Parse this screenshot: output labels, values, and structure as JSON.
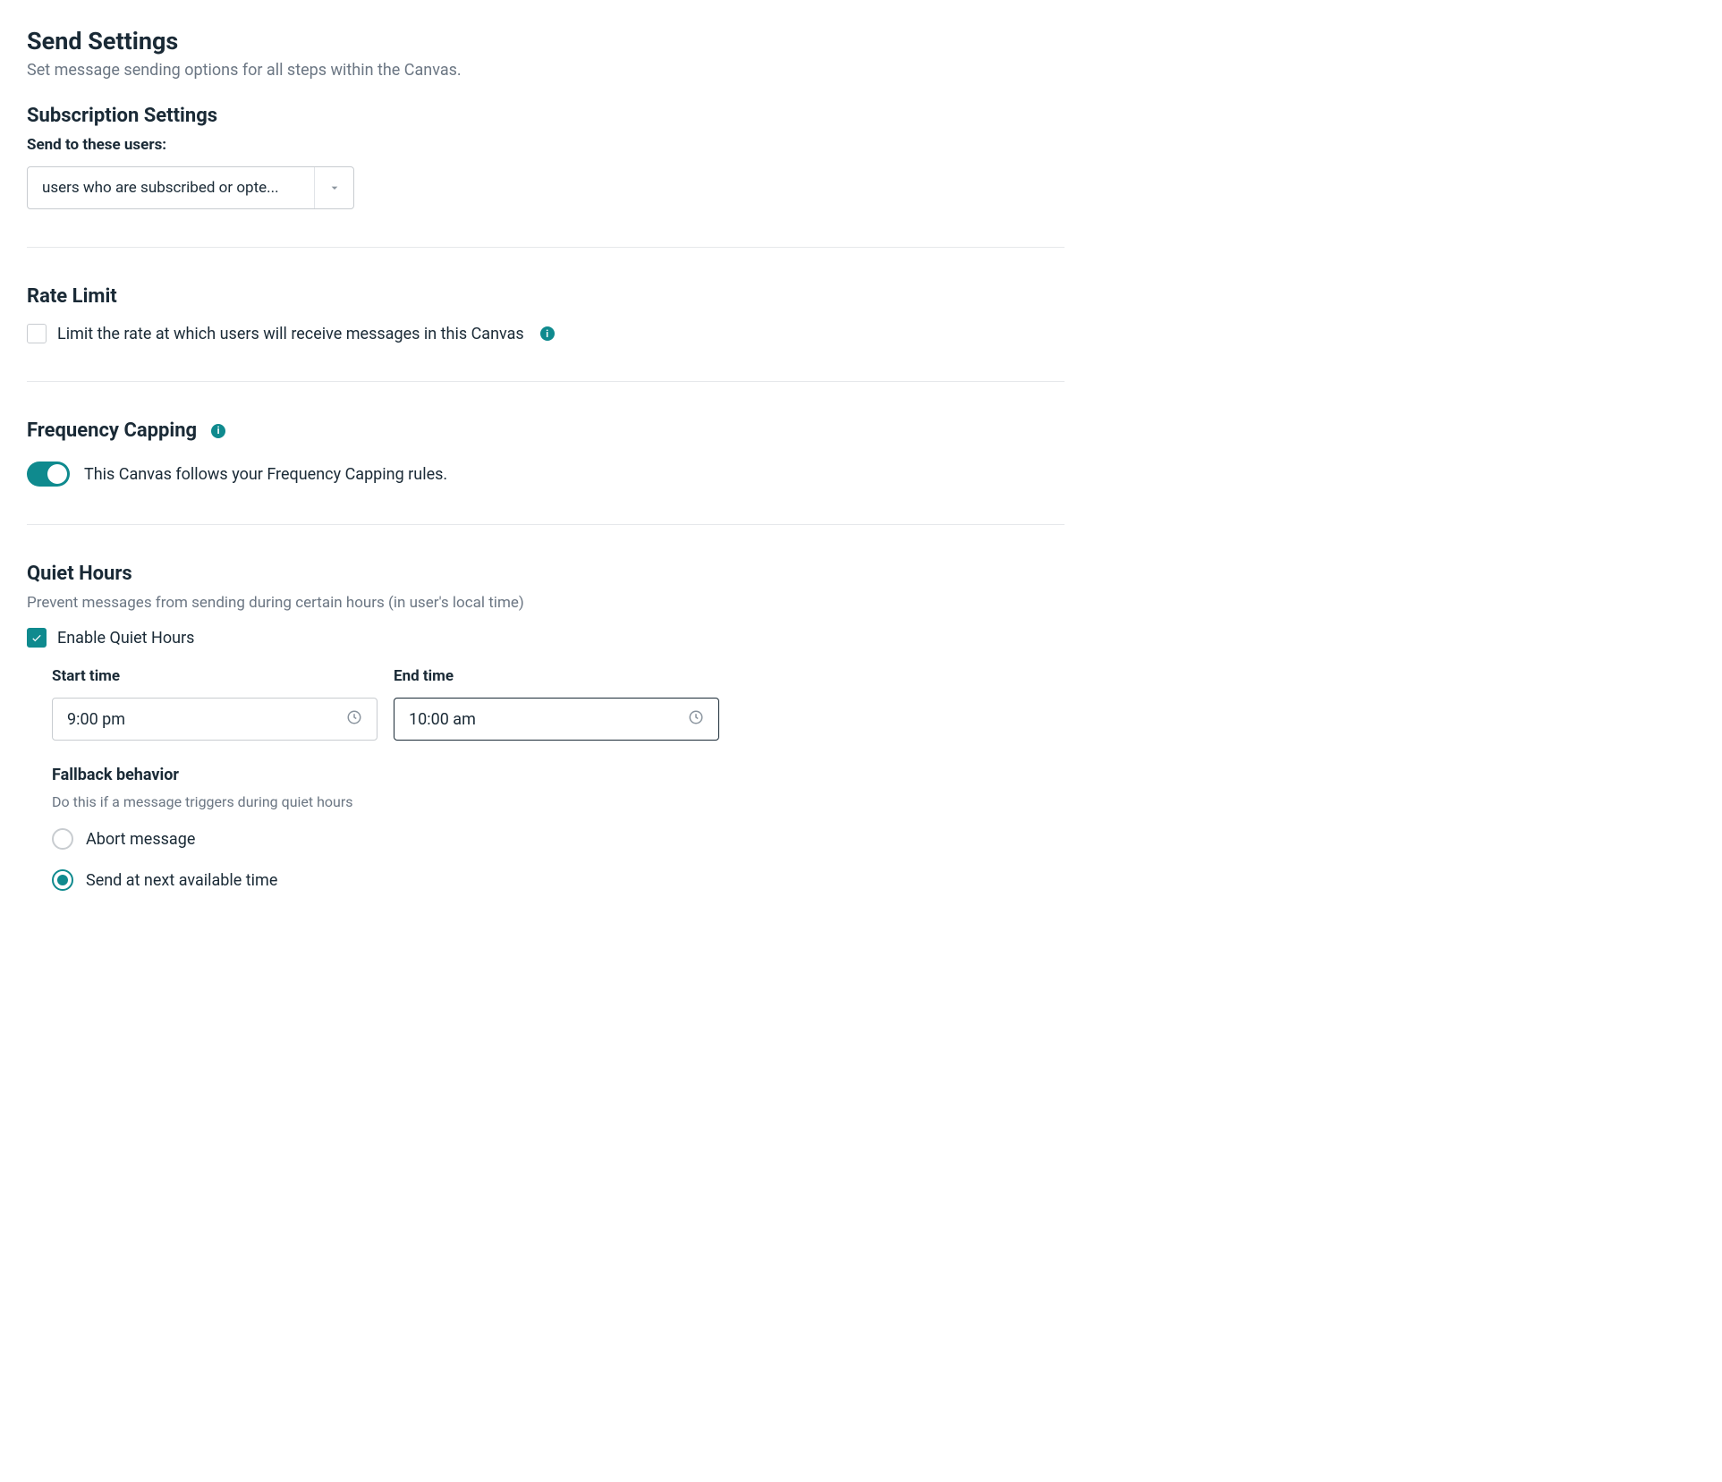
{
  "page": {
    "title": "Send Settings",
    "subtitle": "Set message sending options for all steps within the Canvas."
  },
  "subscription": {
    "title": "Subscription Settings",
    "label": "Send to these users:",
    "selected": "users who are subscribed or opte..."
  },
  "rate_limit": {
    "title": "Rate Limit",
    "checkbox_label": "Limit the rate at which users will receive messages in this Canvas",
    "checked": false
  },
  "frequency_capping": {
    "title": "Frequency Capping",
    "toggle_text": "This Canvas follows your Frequency Capping rules.",
    "enabled": true
  },
  "quiet_hours": {
    "title": "Quiet Hours",
    "subtitle": "Prevent messages from sending during certain hours (in user's local time)",
    "enable_label": "Enable Quiet Hours",
    "enabled": true,
    "start_label": "Start time",
    "start_value": "9:00 pm",
    "end_label": "End time",
    "end_value": "10:00 am",
    "fallback_title": "Fallback behavior",
    "fallback_sub": "Do this if a message triggers during quiet hours",
    "options": {
      "abort": "Abort message",
      "send_next": "Send at next available time"
    },
    "selected_fallback": "send_next"
  }
}
